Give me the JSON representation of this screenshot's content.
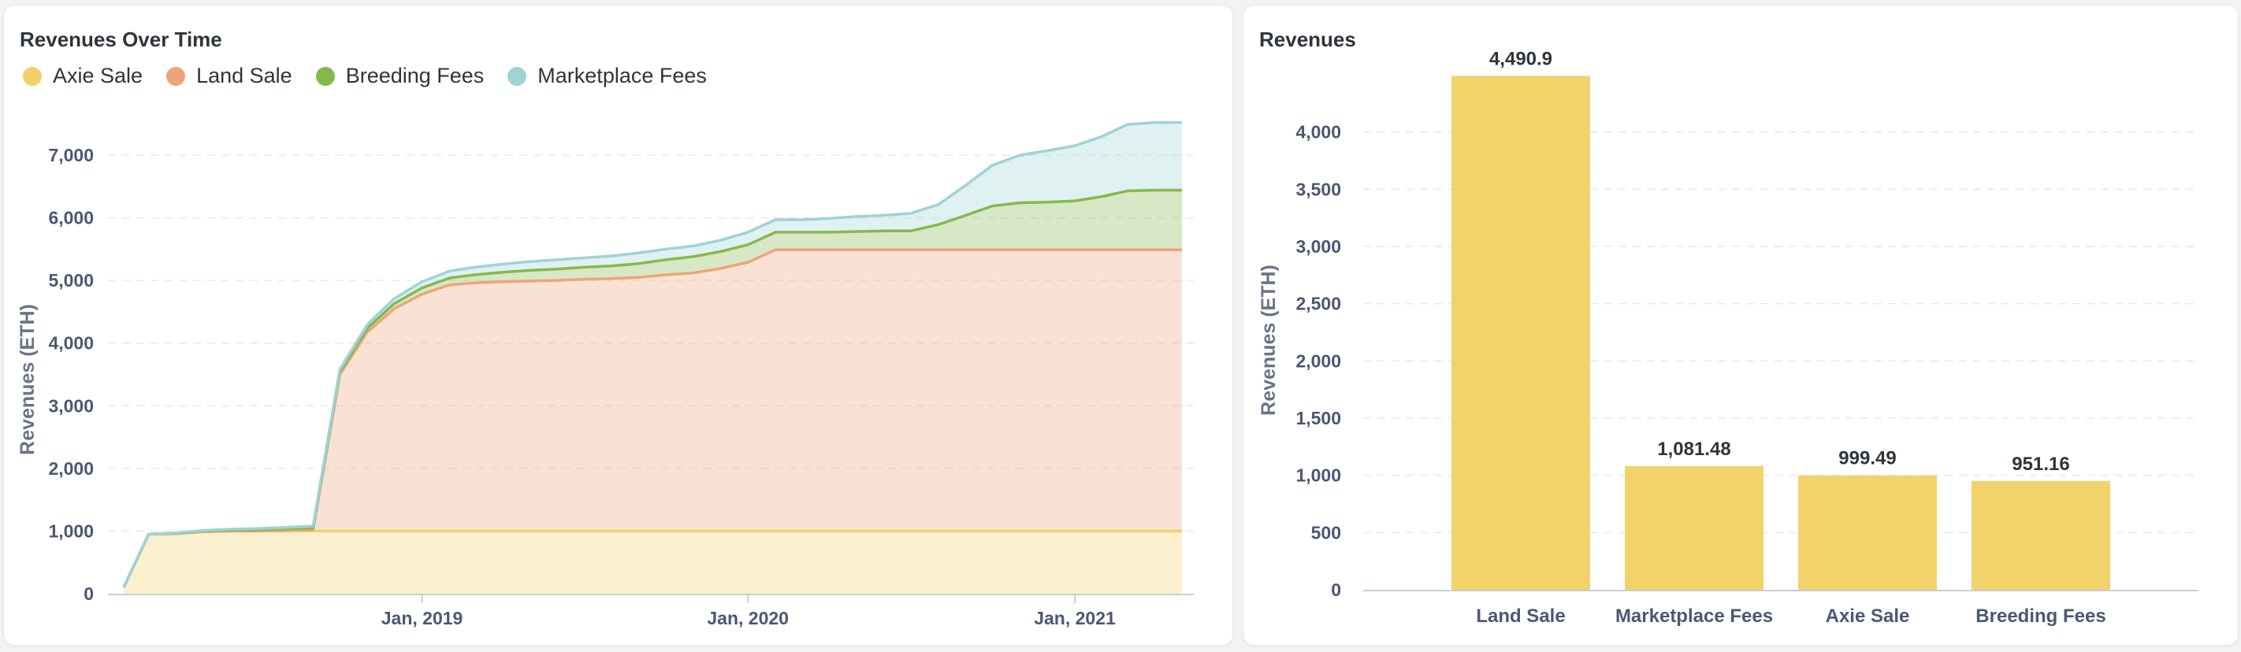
{
  "left_card": {
    "title": "Revenues Over Time"
  },
  "right_card": {
    "title": "Revenues"
  },
  "colors": {
    "axie_sale": "#f2d06b",
    "land_sale": "#eca57a",
    "breeding_fees": "#86b94d",
    "marketplace_fees": "#9fd3d6",
    "bar": "#f2d26b",
    "grid": "#e7e9ec",
    "axis_text": "#4c5773"
  },
  "chart_data": [
    {
      "type": "area",
      "stacked": true,
      "title": "Revenues Over Time",
      "ylabel": "Revenues (ETH)",
      "xlabel": "",
      "ylim": [
        0,
        7000
      ],
      "yticks": [
        0,
        1000,
        2000,
        3000,
        4000,
        5000,
        6000,
        7000
      ],
      "ytick_labels": [
        "0",
        "1,000",
        "2,000",
        "3,000",
        "4,000",
        "5,000",
        "6,000",
        "7,000"
      ],
      "xticks": [
        "2019-01-01",
        "2020-01-01",
        "2021-01-01"
      ],
      "xtick_labels": [
        "Jan, 2019",
        "Jan, 2020",
        "Jan, 2021"
      ],
      "x": [
        "2018-02-01",
        "2018-03-01",
        "2018-04-01",
        "2018-05-01",
        "2018-06-01",
        "2018-07-01",
        "2018-08-01",
        "2018-09-01",
        "2018-10-01",
        "2018-11-01",
        "2018-12-01",
        "2019-01-01",
        "2019-02-01",
        "2019-03-01",
        "2019-04-01",
        "2019-05-01",
        "2019-06-01",
        "2019-07-01",
        "2019-08-01",
        "2019-09-01",
        "2019-10-01",
        "2019-11-01",
        "2019-12-01",
        "2020-01-01",
        "2020-02-01",
        "2020-03-01",
        "2020-04-01",
        "2020-05-01",
        "2020-06-01",
        "2020-07-01",
        "2020-08-01",
        "2020-09-01",
        "2020-10-01",
        "2020-11-01",
        "2020-12-01",
        "2021-01-01",
        "2021-02-01",
        "2021-03-01",
        "2021-04-01",
        "2021-05-01"
      ],
      "series": [
        {
          "name": "Axie Sale",
          "color": "#f2d06b",
          "values": [
            100,
            950,
            960,
            990,
            1000,
            1000,
            1000,
            1000,
            1000,
            1000,
            1000,
            1000,
            1000,
            1000,
            1000,
            1000,
            1000,
            1000,
            1000,
            1000,
            1000,
            1000,
            1000,
            1000,
            1000,
            1000,
            1000,
            1000,
            1000,
            1000,
            1000,
            1000,
            1000,
            1000,
            1000,
            1000,
            1000,
            1000,
            1000,
            1000
          ]
        },
        {
          "name": "Land Sale",
          "color": "#eca57a",
          "values": [
            0,
            0,
            0,
            0,
            0,
            0,
            10,
            20,
            2500,
            3180,
            3550,
            3780,
            3930,
            3960,
            3980,
            3990,
            4000,
            4020,
            4030,
            4050,
            4090,
            4120,
            4190,
            4290,
            4490,
            4490,
            4490,
            4490,
            4490,
            4490,
            4490,
            4490,
            4490,
            4490,
            4490,
            4490,
            4490,
            4490,
            4490,
            4490
          ]
        },
        {
          "name": "Breeding Fees",
          "color": "#86b94d",
          "values": [
            0,
            0,
            5,
            10,
            15,
            20,
            25,
            30,
            40,
            60,
            80,
            100,
            110,
            130,
            150,
            170,
            180,
            190,
            200,
            220,
            240,
            260,
            270,
            280,
            280,
            280,
            280,
            290,
            300,
            300,
            400,
            550,
            700,
            750,
            760,
            780,
            850,
            940,
            951,
            951
          ]
        },
        {
          "name": "Marketplace Fees",
          "color": "#9fd3d6",
          "values": [
            0,
            0,
            5,
            10,
            15,
            20,
            25,
            30,
            40,
            60,
            80,
            100,
            110,
            120,
            130,
            140,
            150,
            150,
            160,
            170,
            170,
            170,
            180,
            200,
            200,
            200,
            220,
            240,
            250,
            280,
            320,
            480,
            650,
            760,
            820,
            880,
            960,
            1060,
            1081,
            1081
          ]
        }
      ]
    },
    {
      "type": "bar",
      "title": "Revenues",
      "ylabel": "Revenues (ETH)",
      "xlabel": "",
      "ylim": [
        0,
        4500
      ],
      "yticks": [
        0,
        500,
        1000,
        1500,
        2000,
        2500,
        3000,
        3500,
        4000
      ],
      "ytick_labels": [
        "0",
        "500",
        "1,000",
        "1,500",
        "2,000",
        "2,500",
        "3,000",
        "3,500",
        "4,000"
      ],
      "categories": [
        "Land Sale",
        "Marketplace Fees",
        "Axie Sale",
        "Breeding Fees"
      ],
      "values": [
        4490.9,
        1081.48,
        999.49,
        951.16
      ],
      "value_labels": [
        "4,490.9",
        "1,081.48",
        "999.49",
        "951.16"
      ]
    }
  ]
}
